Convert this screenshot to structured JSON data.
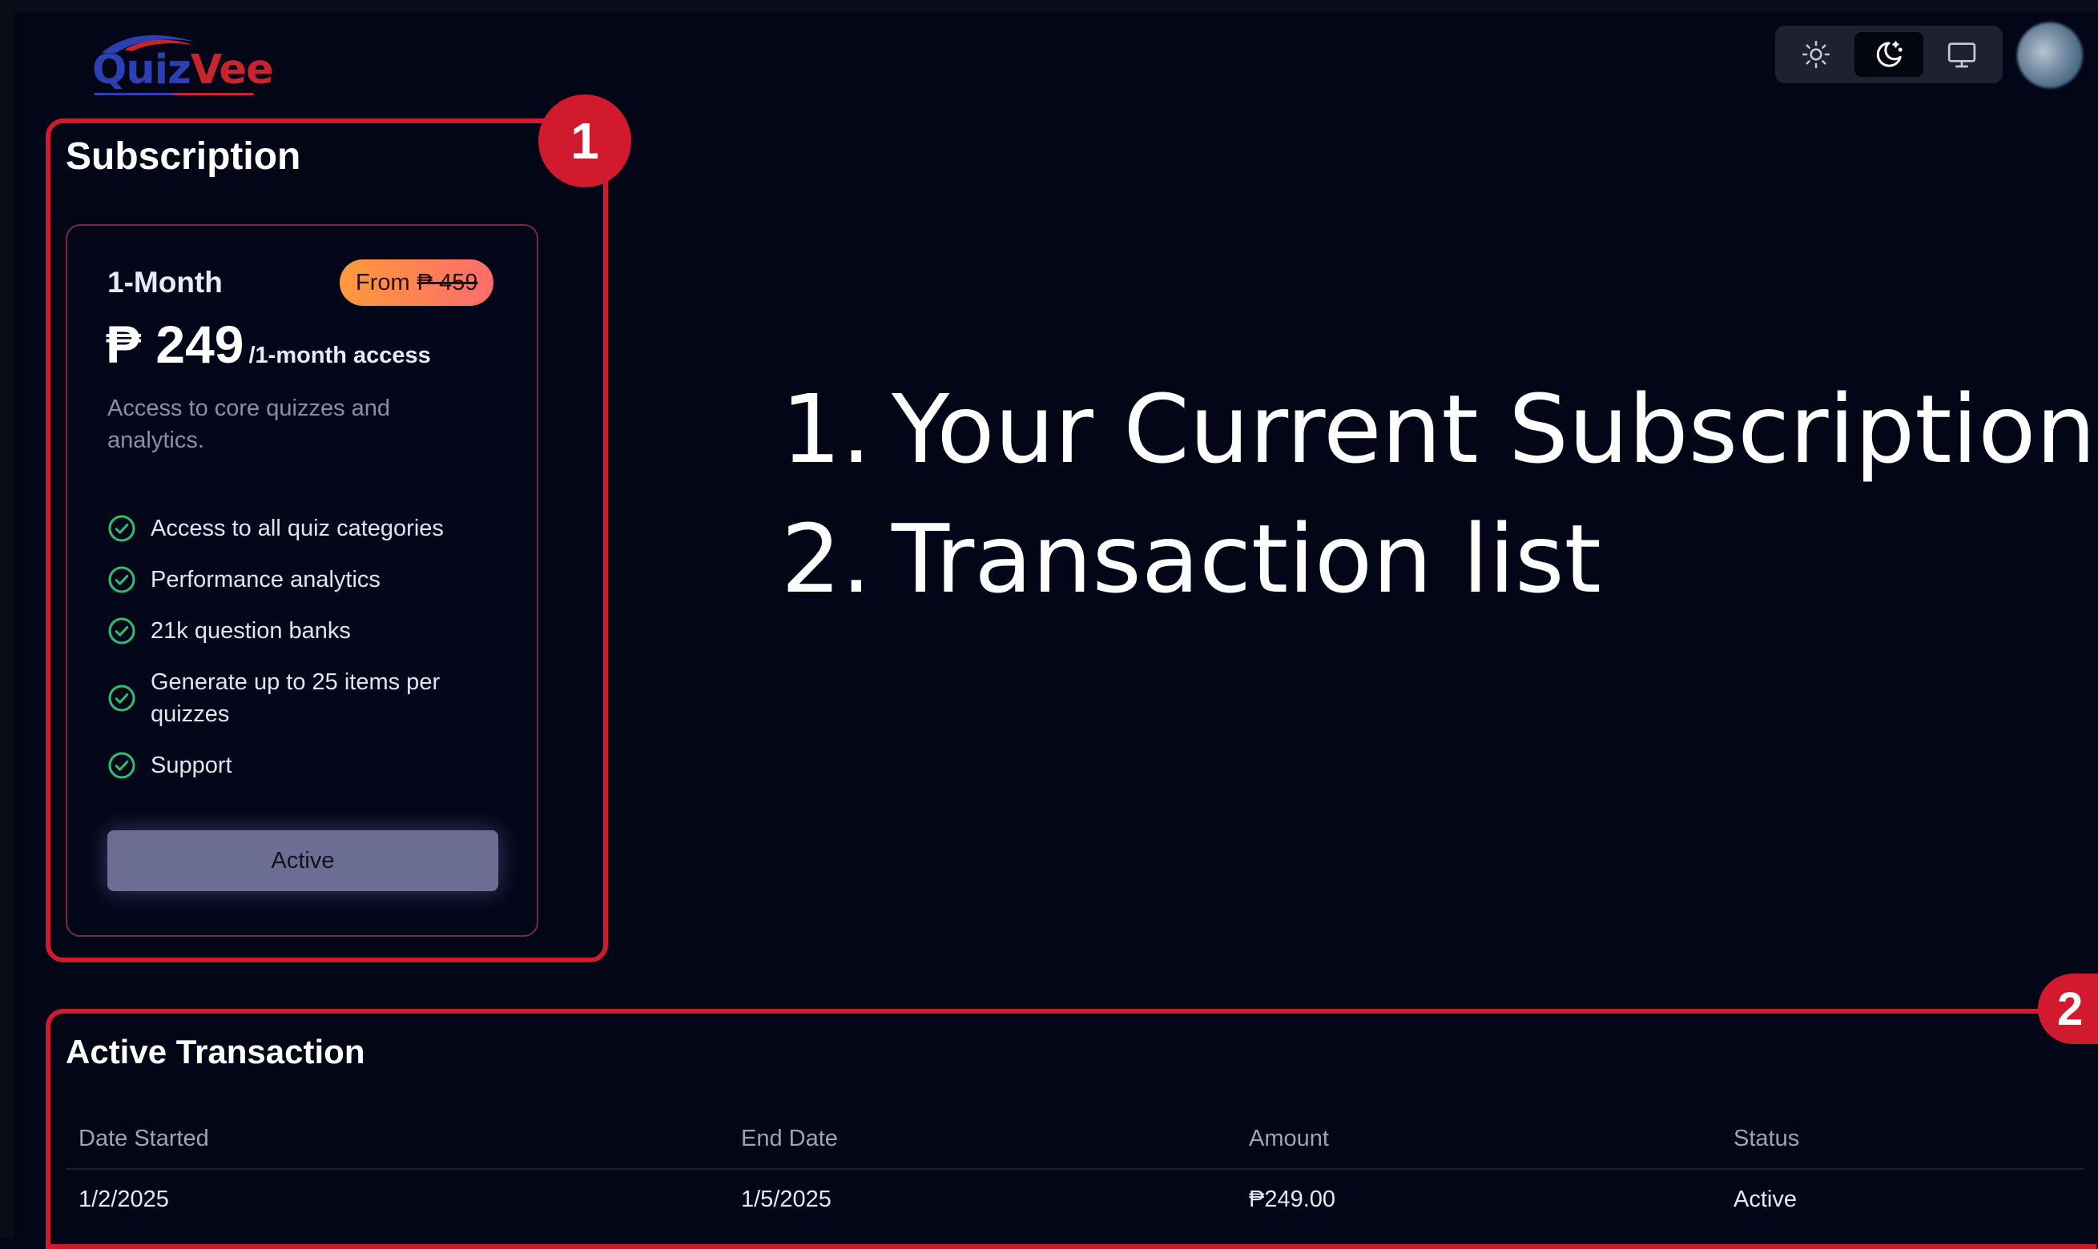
{
  "header": {
    "logo": {
      "part1": "Quiz",
      "part2": "Vee"
    },
    "theme_toggle": {
      "options": [
        "light",
        "dark",
        "system"
      ],
      "selected": "dark"
    },
    "icons": {
      "light": "sun-icon",
      "dark": "moon-icon",
      "system": "monitor-icon"
    }
  },
  "subscription": {
    "title": "Subscription",
    "plan": {
      "name": "1-Month",
      "badge_prefix": "From",
      "badge_old_price": "₱ 459",
      "price": "₱ 249",
      "period": "/1-month access",
      "description": "Access to core quizzes and analytics.",
      "features": [
        "Access to all quiz categories",
        "Performance analytics",
        "21k question banks",
        "Generate up to 25 items per quizzes",
        "Support"
      ],
      "button_label": "Active"
    }
  },
  "annotations": {
    "badges": [
      "1",
      "2"
    ],
    "items": [
      {
        "number": "1.",
        "text": "Your Current Subscription"
      },
      {
        "number": "2.",
        "text": "Transaction list"
      }
    ],
    "color": "#d11a2e"
  },
  "transactions": {
    "title": "Active Transaction",
    "columns": [
      "Date Started",
      "End Date",
      "Amount",
      "Status"
    ],
    "rows": [
      [
        "1/2/2025",
        "1/5/2025",
        "₱249.00",
        "Active"
      ]
    ]
  },
  "colors": {
    "background": "#030616",
    "accent_green": "#2fbf71",
    "badge_gradient": [
      "#ff9a3c",
      "#ff6b6b"
    ],
    "button": "#6c6d92"
  }
}
